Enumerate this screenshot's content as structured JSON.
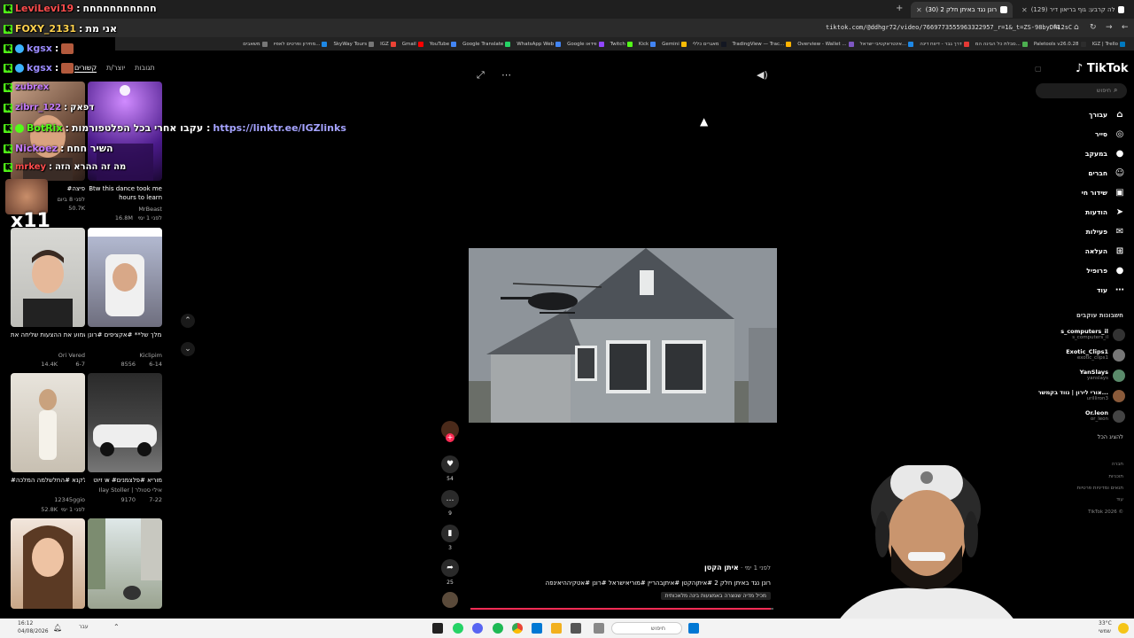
{
  "browser": {
    "tabs": [
      {
        "label": "רונן נגד באיתן חלק 2 (30)",
        "active": true
      },
      {
        "label": "(129) אלה קרבע: גוף בריאון דיר..."
      }
    ],
    "new_tab": "+",
    "url": "tiktok.com/@ddhgr72/video/7669773555963322957_r=1&_t=ZS-98byDn12sC",
    "bookmarks": [
      "IGZ | Trello",
      "Paletools v26.0.28",
      "סבלת כל הבינה המ...",
      "דרך גבר - דיווח דינה",
      "אינטראקטיבי ישראל...",
      "Overview - Wallet ...",
      "TradingView — Trac...",
      "מאגרים כללי",
      "Gemini",
      "Kick",
      "Twitch",
      "Google ווידאו",
      "WhatsApp Web",
      "Google Translate",
      "YouTube",
      "Gmail",
      "IGZ",
      "SkyWay Tours",
      "מחירון ופרטים לאפיו...",
      "משאבים"
    ]
  },
  "chat": {
    "lines": [
      {
        "user": "LeviLevi19",
        "msg": "חחחחחחחחחחח",
        "user_color": "#ff4d4d"
      },
      {
        "user": "FOXY_2131",
        "msg": "אני מת",
        "user_color": "#ffd24d"
      },
      {
        "user": "kgsx",
        "msg": "",
        "user_color": "#9b8bff"
      },
      {
        "user": "kgsx",
        "msg": "",
        "user_color": "#9b8bff"
      },
      {
        "user": "zubrex",
        "msg": "",
        "user_color": "#c77dff"
      },
      {
        "user": "zibrr_122",
        "msg": "דפאק",
        "user_color": "#c77dff"
      },
      {
        "user": "BotRix",
        "msg": "עקבו אחרי בכל הפלטפורמות :",
        "link": "https://linktr.ee/IGZlinks",
        "user_color": "#53fc18"
      },
      {
        "user": "Nickoez",
        "msg": "השיר חחח",
        "user_color": "#c77dff"
      },
      {
        "user": "mrkey",
        "msg": "מה זה ההרא הזה",
        "user_color": "#ff4d4d"
      }
    ],
    "emote_multiplier": "x11"
  },
  "left_panel": {
    "tabs": [
      "קשורים",
      "יוצר/ת",
      "תגובות"
    ],
    "videos": [
      {
        "caption": "#פיצה",
        "meta": "לפני 8 ביום",
        "count": "50.7K",
        "sub": "פיצה"
      },
      {
        "caption": "Btw this dance took me hours to learn",
        "author": "MrBeast",
        "count": "16.8M",
        "time": "לפני 1 ימי"
      },
      {
        "caption": "מת כבר לשמוע את ההצעות שליחה את...",
        "author": "Ori Vered",
        "count": "14.4K",
        "time": "6-7"
      },
      {
        "caption": "רונן על איתן גישים המלך של** #אקציפים #רונן...",
        "author": "Kiclipim",
        "count": "8556",
        "time": "6-14"
      },
      {
        "caption": "#לא לקנא #החלשלמה המלכה...",
        "author": "12345ggio",
        "count": "52.8K",
        "time": "לפני 1 ימי"
      },
      {
        "caption": "זיוט w #מוריא #פלצמנים",
        "author": "Ilay Stoller | אילי סטולר",
        "count": "9170",
        "time": "7-22"
      },
      {
        "caption": "",
        "author": "",
        "count": "",
        "time": ""
      },
      {
        "caption": "",
        "author": "",
        "count": "",
        "time": ""
      }
    ]
  },
  "player": {
    "author": "איתן הקטן",
    "time": "לפני 1 ימי",
    "description": "רונן נגד באיתן חלק 2 #איתןהקטן #איתןבהריין #מוריאישראל #רונן #אטקיההיאינפה",
    "ai_label": "מכיל מדיה שנוצרה באמצעות בינה מלאכותית",
    "progress": 0.99,
    "actions": [
      {
        "icon": "heart-icon",
        "count": "54",
        "glyph": "♥"
      },
      {
        "icon": "comment-icon",
        "count": "9",
        "glyph": "…"
      },
      {
        "icon": "bookmark-icon",
        "count": "3",
        "glyph": "▮"
      },
      {
        "icon": "share-icon",
        "count": "25",
        "glyph": "➦"
      }
    ]
  },
  "sidebar": {
    "logo": "TikTok",
    "search_placeholder": "חיפוש",
    "nav": [
      {
        "label": "עבורך",
        "icon": "home-icon",
        "glyph": "⌂"
      },
      {
        "label": "סייר",
        "icon": "explore-icon",
        "glyph": "◎"
      },
      {
        "label": "במעקב",
        "icon": "following-icon",
        "glyph": "●"
      },
      {
        "label": "חברים",
        "icon": "friends-icon",
        "glyph": "☺"
      },
      {
        "label": "שידור חי",
        "icon": "live-icon",
        "glyph": "▣"
      },
      {
        "label": "הודעות",
        "icon": "messages-icon",
        "glyph": "➤"
      },
      {
        "label": "פעילות",
        "icon": "activity-icon",
        "glyph": "✉"
      },
      {
        "label": "העלאה",
        "icon": "upload-icon",
        "glyph": "⊞"
      },
      {
        "label": "פרופיל",
        "icon": "profile-icon",
        "glyph": "●"
      },
      {
        "label": "עוד",
        "icon": "more-icon",
        "glyph": "⋯"
      }
    ],
    "following_title": "חשבונות עוקבים",
    "following": [
      {
        "name": "s_computers_il",
        "handle": "s_computers_il"
      },
      {
        "name": "Exotic_Clips1",
        "handle": "exotic_clips1"
      },
      {
        "name": "YanSlays",
        "handle": "yanslays"
      },
      {
        "name": "אורי לירון | נווד בקמשר...",
        "handle": "urilliron3"
      },
      {
        "name": "Or.leon",
        "handle": "or_leon"
      }
    ],
    "show_more": "להציג הכל",
    "footer": [
      "חברה",
      "תוכניות",
      "תנאים ומדיניות פרטיות",
      "עוד",
      "TikTok 2026 ©"
    ]
  },
  "taskbar": {
    "time": "16:12",
    "date": "04/08/2026",
    "weather": "33°C",
    "weather_sub": "שמשי",
    "search": "חיפוש",
    "lang": "עבר"
  }
}
